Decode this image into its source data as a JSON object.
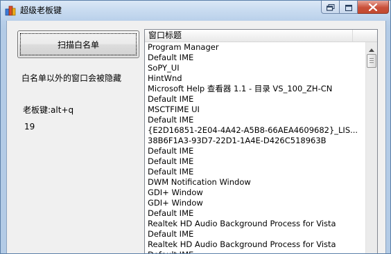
{
  "window": {
    "title": "超级老板键",
    "icon": "app-icon"
  },
  "caption": {
    "minimize_icon": "restore-down-icon",
    "maximize_icon": "maximize-icon",
    "close_icon": "close-icon"
  },
  "left_panel": {
    "scan_button_label": "扫描白名单",
    "hide_note": "白名单以外的窗口会被隐藏",
    "boss_key": "老板键:alt+q",
    "count": "19"
  },
  "list": {
    "column_header": "窗口标题",
    "rows": [
      "Program Manager",
      "Default IME",
      "SoPY_UI",
      "HintWnd",
      "Microsoft Help 查看器 1.1 - 目录 VS_100_ZH-CN",
      "Default IME",
      "MSCTFIME UI",
      "Default IME",
      "{E2D16851-2E04-4A42-A5B8-66AEA4609682}_LIS...",
      "38B6F1A3-93D7-22D1-1A4E-D426C518963B",
      "Default IME",
      "Default IME",
      "Default IME",
      "DWM Notification Window",
      "GDI+ Window",
      "GDI+ Window",
      "Default IME",
      "Realtek HD Audio Background Process for Vista",
      "Default IME",
      "Realtek HD Audio Background Process for Vista",
      "Default IME"
    ]
  },
  "colors": {
    "frame": "#b9d0ea",
    "client": "#f0f0f0",
    "close_button": "#c9503a"
  }
}
